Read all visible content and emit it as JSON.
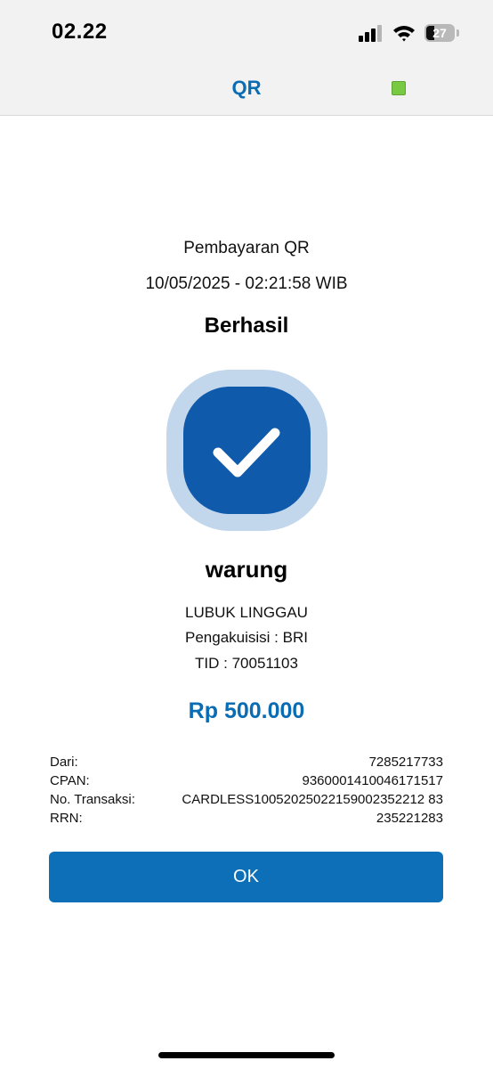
{
  "status_bar": {
    "time": "02.22",
    "battery_level": "27",
    "icons": [
      "signal-icon",
      "wifi-icon",
      "battery-icon"
    ]
  },
  "header": {
    "title": "QR",
    "indicator_color": "#7ac943"
  },
  "transaction": {
    "type": "Pembayaran QR",
    "datetime": "10/05/2025 - 02:21:58 WIB",
    "status": "Berhasil",
    "status_icon": "checkmark-icon"
  },
  "merchant": {
    "name": "warung",
    "city": "LUBUK LINGGAU",
    "acquirer": "Pengakuisisi : BRI",
    "tid": "TID : 70051103"
  },
  "amount": "Rp 500.000",
  "details": [
    {
      "label": "Dari:",
      "value": "7285217733"
    },
    {
      "label": "CPAN:",
      "value": "9360001410046171517"
    },
    {
      "label": "No. Transaksi:",
      "value": "CARDLESS10052025022159002352212 83"
    },
    {
      "label": "RRN:",
      "value": "235221283"
    }
  ],
  "actions": {
    "ok_label": "OK"
  },
  "colors": {
    "accent": "#0a6cb3",
    "button": "#0d6fb8",
    "badge_outer": "#c2d6ec",
    "badge_inner": "#0f5aaa"
  }
}
